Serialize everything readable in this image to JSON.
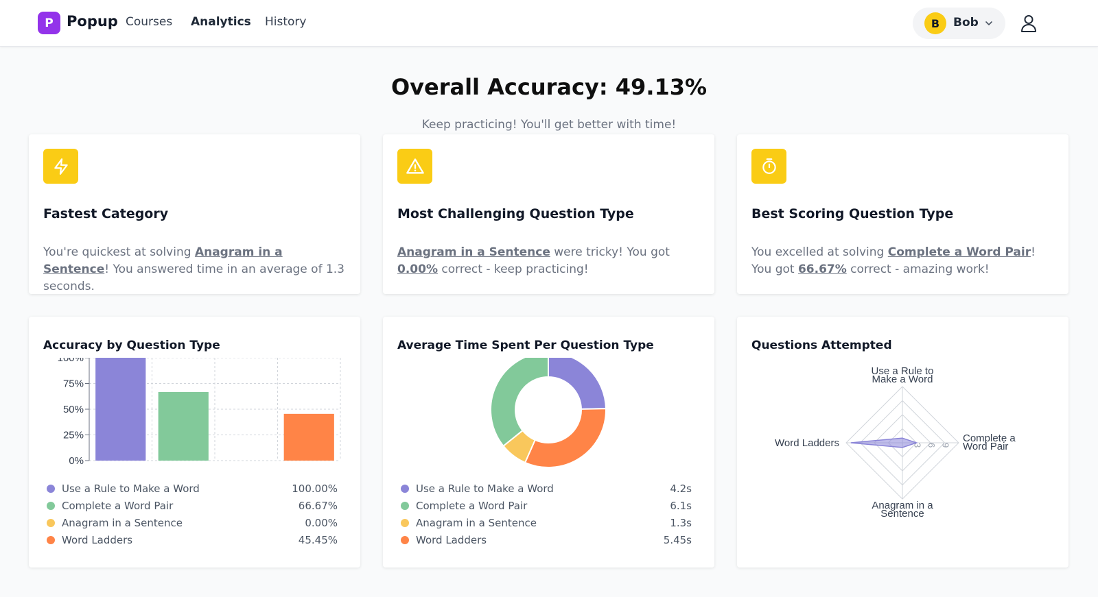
{
  "nav": {
    "logo_letter": "P",
    "logo_text": "Popup",
    "links": [
      "Courses",
      "Analytics",
      "History"
    ],
    "user_initial": "B",
    "user_name": "Bob"
  },
  "header": {
    "title": "Overall Accuracy: 49.13%",
    "subtitle": "Keep practicing! You'll get better with time!"
  },
  "cards": {
    "fastest": {
      "title": "Fastest Category",
      "pre": "You're quickest at solving ",
      "link": "Anagram in a Sentence",
      "post": "! You answered time in an average of 1.3 seconds."
    },
    "challenging": {
      "title": "Most Challenging Question Type",
      "link": "Anagram in a Sentence",
      "mid": " were tricky! You got ",
      "pct": "0.00%",
      "post": " correct - keep practicing!"
    },
    "best": {
      "title": "Best Scoring Question Type",
      "pre": "You excelled at solving ",
      "link": "Complete a Word Pair",
      "mid": "! You got ",
      "pct": "66.67%",
      "post": " correct - amazing work!"
    }
  },
  "colors": {
    "purple": "#8b85d8",
    "green": "#82c99a",
    "yellow": "#f9c75c",
    "orange": "#ff8447",
    "accent": "#facc15",
    "brand": "#9333ea"
  },
  "chart_data": [
    {
      "type": "bar",
      "title": "Accuracy by Question Type",
      "categories": [
        "Use a Rule to Make a Word",
        "Complete a Word Pair",
        "Anagram in a Sentence",
        "Word Ladders"
      ],
      "values": [
        100,
        66.67,
        0,
        45.45
      ],
      "value_labels": [
        "100.00%",
        "66.67%",
        "0.00%",
        "45.45%"
      ],
      "yticks": [
        "100%",
        "75%",
        "50%",
        "25%",
        "0%"
      ],
      "ylim": [
        0,
        100
      ],
      "grid": true
    },
    {
      "type": "pie",
      "title": "Average Time Spent Per Question Type",
      "categories": [
        "Use a Rule to Make a Word",
        "Complete a Word Pair",
        "Anagram in a Sentence",
        "Word Ladders"
      ],
      "values": [
        4.2,
        6.1,
        1.3,
        5.45
      ],
      "value_labels": [
        "4.2s",
        "6.1s",
        "1.3s",
        "5.45s"
      ],
      "display_order": [
        0,
        3,
        2,
        1
      ]
    },
    {
      "type": "radar",
      "title": "Questions Attempted",
      "axes": [
        [
          "Use a Rule to",
          "Make a Word"
        ],
        [
          "Complete a",
          "Word Pair"
        ],
        [
          "Anagram in a",
          "Sentence"
        ],
        [
          "Word Ladders"
        ]
      ],
      "values": [
        1,
        3,
        1,
        11
      ],
      "rmax": 12,
      "tick_labels": [
        "3",
        "6",
        "9"
      ]
    }
  ]
}
